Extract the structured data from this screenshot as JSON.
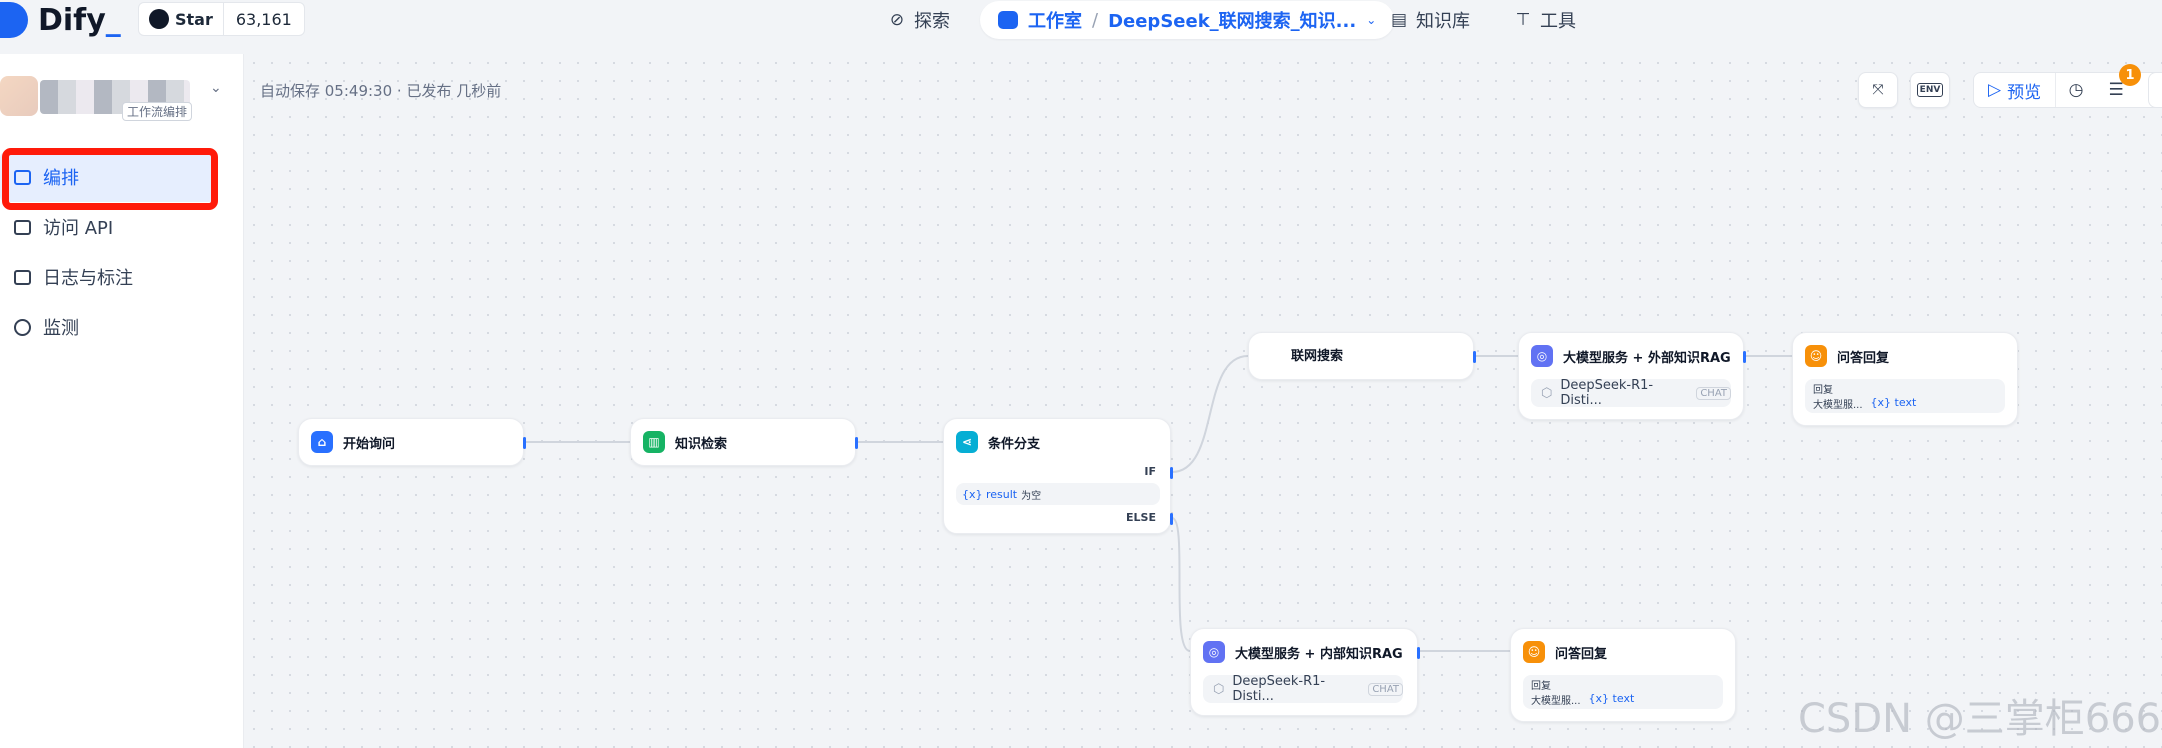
{
  "header": {
    "logo_text": "Dify",
    "star_label": "Star",
    "star_count": "63,161",
    "nav_explore": "探索",
    "nav_studio": "工作室",
    "app_breadcrumb": "DeepSeek_联网搜索_知识...",
    "nav_knowledge": "知识库",
    "nav_tools": "工具"
  },
  "sidebar": {
    "app_tag": "工作流编排",
    "items": [
      {
        "label": "编排",
        "icon": "layout-icon",
        "active": true
      },
      {
        "label": "访问 API",
        "icon": "terminal-icon",
        "active": false
      },
      {
        "label": "日志与标注",
        "icon": "file-list-icon",
        "active": false
      },
      {
        "label": "监测",
        "icon": "gauge-icon",
        "active": false
      }
    ]
  },
  "toolbar": {
    "autosave": "自动保存 05:49:30 · 已发布 几秒前",
    "env_label": "ENV",
    "preview_label": "预览",
    "badge_count": "1"
  },
  "nodes": {
    "start": {
      "title": "开始询问"
    },
    "knowledge": {
      "title": "知识检索"
    },
    "ifelse": {
      "title": "条件分支",
      "if_label": "IF",
      "var": "{x} result",
      "cond": "为空",
      "else_label": "ELSE"
    },
    "web": {
      "title": "联网搜索"
    },
    "llm_ext": {
      "title": "大模型服务 + 外部知识RAG",
      "model": "DeepSeek-R1-Disti...",
      "tag": "CHAT"
    },
    "ans_top": {
      "title": "问答回复",
      "label": "回复",
      "src": "大模型服...",
      "var": "{x} text"
    },
    "llm_int": {
      "title": "大模型服务 + 内部知识RAG",
      "model": "DeepSeek-R1-Disti...",
      "tag": "CHAT"
    },
    "ans_bot": {
      "title": "问答回复",
      "label": "回复",
      "src": "大模型服...",
      "var": "{x} text"
    }
  },
  "watermark": "CSDN @三掌柜666",
  "colors": {
    "accent": "#1c64f2",
    "highlight": "#ff1a0a",
    "start": "#2970ff",
    "knowledge": "#16b364",
    "ifelse": "#06aed4",
    "llm": "#6172f3",
    "answer": "#f79009"
  }
}
